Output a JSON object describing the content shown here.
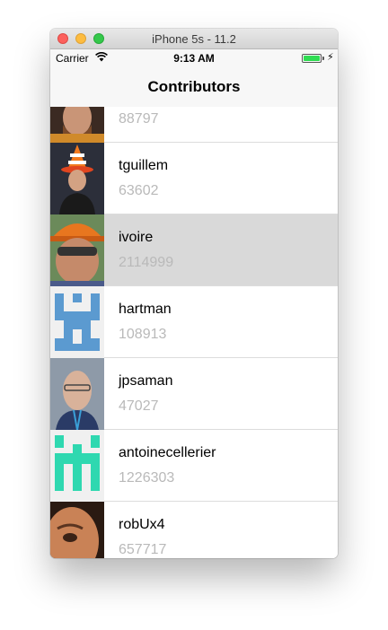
{
  "window": {
    "title": "iPhone 5s - 11.2"
  },
  "statusbar": {
    "carrier": "Carrier",
    "time": "9:13 AM",
    "battery_level": 1.0
  },
  "navbar": {
    "title": "Contributors"
  },
  "contributors": [
    {
      "name": "",
      "count": "88797",
      "avatar_icon": "person-photo-icon"
    },
    {
      "name": "tguillem",
      "count": "63602",
      "avatar_icon": "person-photo-icon"
    },
    {
      "name": "ivoire",
      "count": "2114999",
      "avatar_icon": "person-photo-icon",
      "selected": true
    },
    {
      "name": "hartman",
      "count": "108913",
      "avatar_icon": "identicon-icon"
    },
    {
      "name": "jpsaman",
      "count": "47027",
      "avatar_icon": "person-photo-icon"
    },
    {
      "name": "antoinecellerier",
      "count": "1226303",
      "avatar_icon": "identicon-icon"
    },
    {
      "name": "robUx4",
      "count": "657717",
      "avatar_icon": "person-photo-icon"
    }
  ],
  "colors": {
    "selected_row": "#d9d9d9",
    "count_text": "#b9b9b9",
    "identicon_blue": "#5b9ad0",
    "identicon_teal": "#2fd8b0"
  }
}
